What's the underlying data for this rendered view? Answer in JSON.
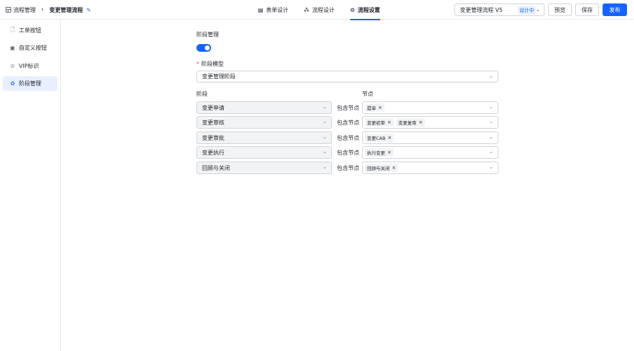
{
  "header": {
    "breadcrumb_parent": "流程管理",
    "breadcrumb_current": "变更管理流程",
    "tabs": [
      {
        "label": "表单设计",
        "icon": "document-icon"
      },
      {
        "label": "流程设计",
        "icon": "flow-icon"
      },
      {
        "label": "流程设置",
        "icon": "gear-icon"
      }
    ],
    "active_tab": "流程设置",
    "version_name": "变更管理流程 V5",
    "version_status": "设计中",
    "preview_label": "预览",
    "save_label": "保存",
    "publish_label": "发布"
  },
  "sidebar": {
    "items": [
      {
        "label": "工单按钮",
        "icon": "file-icon"
      },
      {
        "label": "自定义按钮",
        "icon": "custom-button-icon"
      },
      {
        "label": "VIP标识",
        "icon": "crown-icon"
      },
      {
        "label": "阶段管理",
        "icon": "recycle-icon"
      }
    ],
    "active": "阶段管理"
  },
  "main": {
    "section_title": "阶段管理",
    "toggle_enabled": true,
    "model_label": "阶段模型",
    "model_required_mark": "*",
    "model_value": "变更管理阶段",
    "col_stage": "阶段",
    "col_node": "节点",
    "rows": [
      {
        "stage": "变更申请",
        "contains": "包含节点",
        "nodes": [
          "提单"
        ]
      },
      {
        "stage": "变更审核",
        "contains": "包含节点",
        "nodes": [
          "变更初审",
          "变更复审"
        ]
      },
      {
        "stage": "变更审批",
        "contains": "包含节点",
        "nodes": [
          "变更CAB"
        ]
      },
      {
        "stage": "变更执行",
        "contains": "包含节点",
        "nodes": [
          "执行变更"
        ]
      },
      {
        "stage": "回顾与关闭",
        "contains": "包含节点",
        "nodes": [
          "回顾与关闭"
        ]
      }
    ]
  },
  "colors": {
    "accent": "#1664ff",
    "required": "#f54a45",
    "border": "#d0d3d6"
  }
}
